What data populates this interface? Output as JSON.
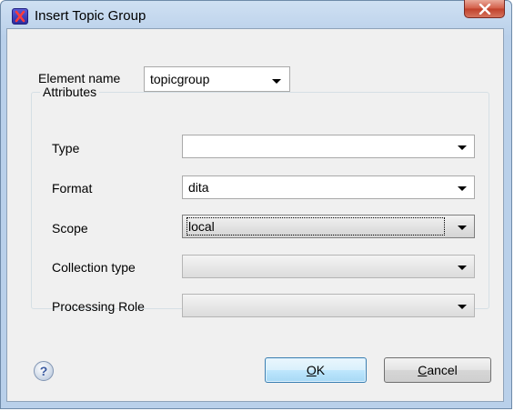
{
  "window": {
    "title": "Insert Topic Group"
  },
  "element_name": {
    "label": "Element name",
    "value": "topicgroup"
  },
  "attributes": {
    "title": "Attributes",
    "fields": [
      {
        "label": "Type",
        "value": ""
      },
      {
        "label": "Format",
        "value": "dita"
      },
      {
        "label": "Scope",
        "value": "local"
      },
      {
        "label": "Collection type",
        "value": ""
      },
      {
        "label": "Processing Role",
        "value": ""
      }
    ]
  },
  "buttons": {
    "help": "?",
    "ok_accel": "O",
    "ok_rest": "K",
    "cancel_accel": "C",
    "cancel_rest": "ancel"
  }
}
